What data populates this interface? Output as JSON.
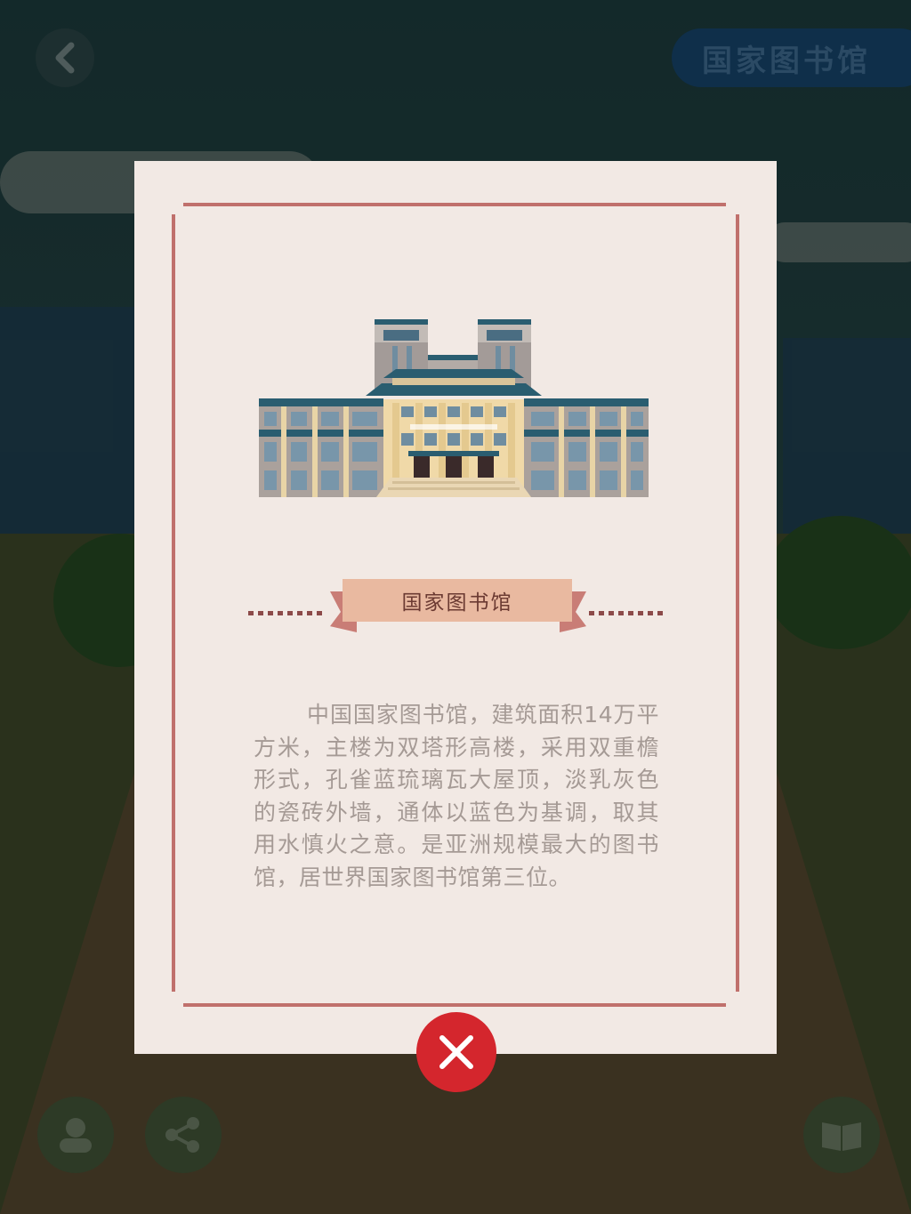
{
  "header": {
    "back_icon": "chevron-left-icon",
    "location_label": "国家图书馆"
  },
  "card": {
    "illustration": "national-library-building",
    "title": "国家图书馆",
    "description": "中国国家图书馆，建筑面积14万平方米，主楼为双塔形高楼，采用双重檐形式，孔雀蓝琉璃瓦大屋顶，淡乳灰色的瓷砖外墙，通体以蓝色为基调，取其用水慎火之意。是亚洲规模最大的图书馆，居世界国家图书馆第三位。"
  },
  "bottom_bar": {
    "left_icon": "person-icon",
    "share_icon": "share-icon",
    "right_icon": "book-icon"
  },
  "close_icon": "close-icon",
  "colors": {
    "card_bg": "#f2e9e4",
    "frame": "#c0706c",
    "ribbon": "#e9b9a0",
    "text": "#a59a95",
    "close": "#d4262d"
  }
}
